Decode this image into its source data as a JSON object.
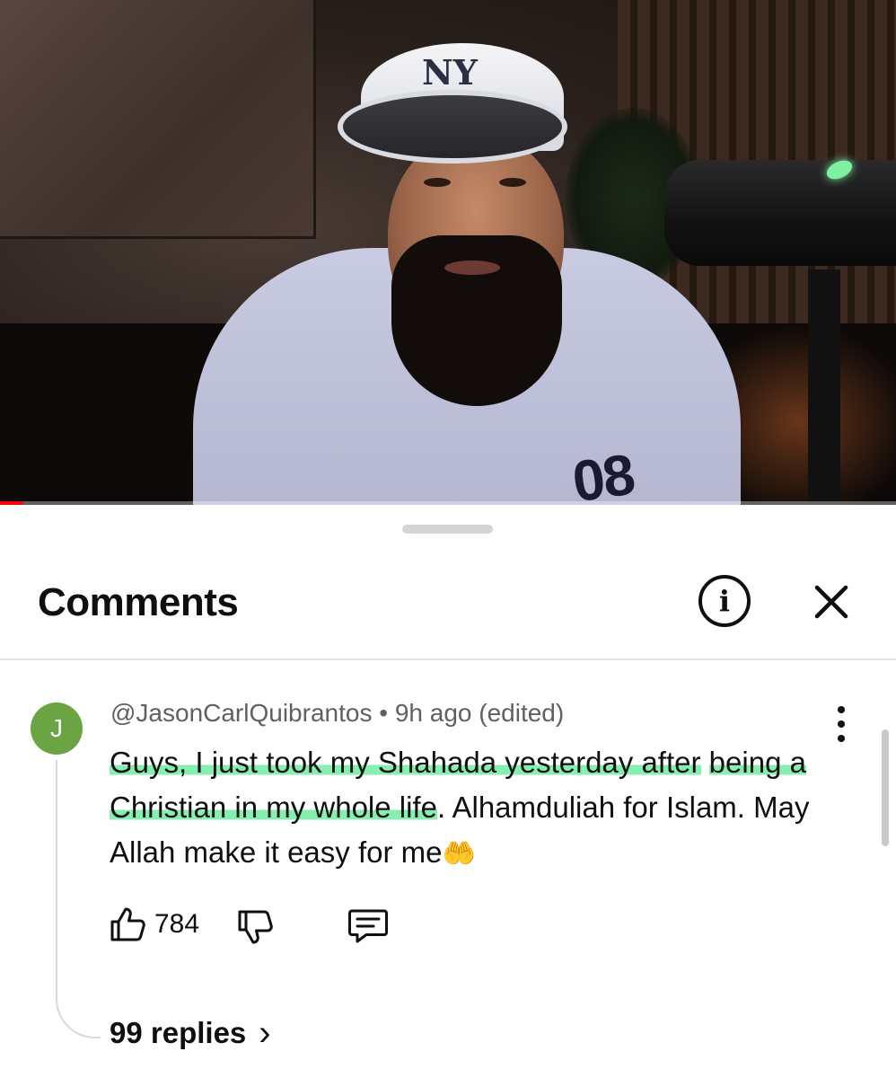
{
  "video": {
    "progress_fraction": 0.025,
    "shirt_number": "08",
    "cap_logo": "NY"
  },
  "comments_panel": {
    "title": "Comments",
    "info_icon": "info-circle-icon",
    "close_icon": "close-icon"
  },
  "comment": {
    "avatar_letter": "J",
    "avatar_color": "#6aa443",
    "author": "@JasonCarlQuibrantos",
    "separator": "•",
    "time": "9h ago",
    "edited": "(edited)",
    "text_highlighted_1": "Guys, I just took my Shahada yesterday after",
    "text_highlighted_2": "being a Christian in my whole life",
    "text_rest": ". Alhamduliah for Islam. May Allah make it easy for me",
    "emoji": "🤲",
    "highlight_color": "#5eea96",
    "likes": "784",
    "replies_label": "99 replies",
    "replies_chevron": "›"
  }
}
